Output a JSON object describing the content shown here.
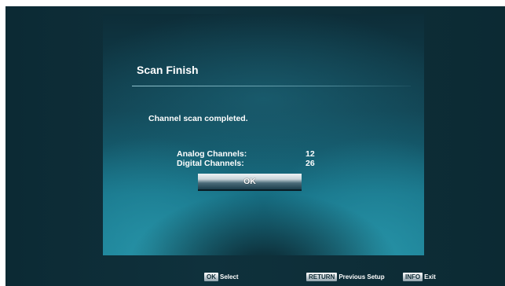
{
  "dialog": {
    "title": "Scan Finish",
    "message": "Channel scan completed.",
    "analog_label": "Analog Channels:",
    "analog_value": "12",
    "digital_label": "Digital Channels:",
    "digital_value": "26",
    "ok_label": "OK"
  },
  "footer": {
    "select_key": "OK",
    "select_label": "Select",
    "return_key": "RETURN",
    "return_label": "Previous Setup",
    "info_key": "INFO",
    "info_label": "Exit"
  },
  "colors": {
    "background": "#0f313c",
    "panel_accent": "#1a7a90",
    "text": "#ffffff"
  }
}
